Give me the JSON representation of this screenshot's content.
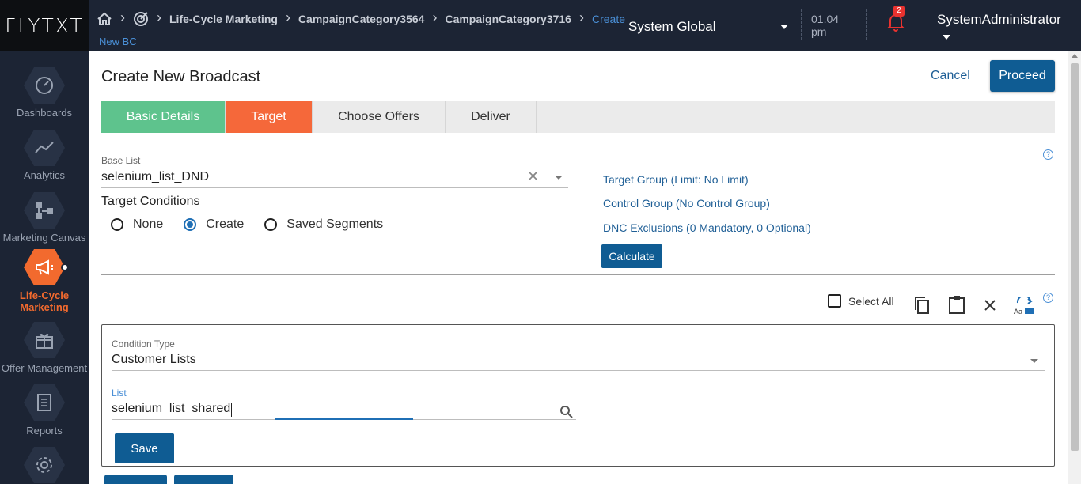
{
  "header": {
    "logo": "FLYTXT",
    "breadcrumbs": [
      "Life-Cycle Marketing",
      "CampaignCategory3564",
      "CampaignCategory3716"
    ],
    "breadcrumb_current": "Create",
    "breadcrumb_sub": "New BC",
    "environment": "System Global",
    "time": "01.04",
    "time_suffix": "pm",
    "notification_count": "2",
    "user": "SystemAdministrator"
  },
  "sidebar": {
    "items": [
      {
        "label": "Dashboards",
        "icon": "dashboard-icon"
      },
      {
        "label": "Analytics",
        "icon": "analytics-icon"
      },
      {
        "label": "Marketing Canvas",
        "icon": "marketing-canvas-icon"
      },
      {
        "label": "Life-Cycle Marketing",
        "icon": "megaphone-icon",
        "active": true
      },
      {
        "label": "Offer Management",
        "icon": "gift-icon"
      },
      {
        "label": "Reports",
        "icon": "report-icon"
      },
      {
        "label": "",
        "icon": "settings-icon"
      }
    ]
  },
  "page": {
    "title": "Create New Broadcast",
    "cancel_label": "Cancel",
    "proceed_label": "Proceed",
    "tabs": [
      "Basic Details",
      "Target",
      "Choose Offers",
      "Deliver"
    ]
  },
  "target": {
    "base_list_label": "Base List",
    "base_list_value": "selenium_list_DND",
    "conditions_label": "Target Conditions",
    "options": [
      "None",
      "Create",
      "Saved Segments"
    ],
    "selected_option": "Create",
    "target_group": "Target Group (Limit: No Limit)",
    "control_group": "Control Group (No Control Group)",
    "dnc_exclusions": "DNC Exclusions (0 Mandatory, 0 Optional)",
    "calculate_label": "Calculate",
    "help_symbol": "?"
  },
  "condition_toolbar": {
    "select_all_label": "Select All"
  },
  "condition": {
    "type_label": "Condition Type",
    "type_value": "Customer Lists",
    "list_label": "List",
    "list_value": "selenium_list_shared",
    "save_label": "Save"
  },
  "colors": {
    "nav_bg": "#1c2434",
    "accent_orange": "#f26a2e",
    "tab_done": "#5ec38d",
    "primary": "#0f5c93",
    "link": "#1f5f96"
  }
}
